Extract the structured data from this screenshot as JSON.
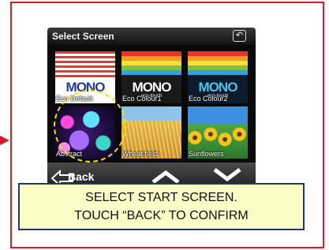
{
  "screen": {
    "title": "Select Screen",
    "tiles": [
      {
        "label": "Eco Default",
        "kind": "mono",
        "word": "MONO",
        "word_color": "#1d3f93",
        "sub": ""
      },
      {
        "label": "Eco Colour1",
        "kind": "mono",
        "word": "MONO",
        "word_color": "#ffffff",
        "sub": "eco-touch"
      },
      {
        "label": "Eco Colour2",
        "kind": "mono",
        "word": "MONO",
        "word_color": "#4cc3e8",
        "sub": "eco-touch"
      },
      {
        "label": "Abstract",
        "kind": "abstract"
      },
      {
        "label": "Wheat field",
        "kind": "wheat"
      },
      {
        "label": "Sunflowers",
        "kind": "sunflowers"
      }
    ],
    "selected_tile": "Eco Default",
    "nav": {
      "back_label": "Back",
      "back_icon": "back-arrow-icon",
      "up_icon": "chevron-up-icon",
      "down_icon": "chevron-down-icon"
    }
  },
  "callout": {
    "line1": "SELECT START SCREEN.",
    "line2": "TOUCH “BACK” TO CONFIRM"
  },
  "colors": {
    "frame": "#d81b25",
    "highlight": "#f4e20c",
    "callout_bg": "#fbfcc6",
    "callout_border": "#1f3a5c"
  }
}
